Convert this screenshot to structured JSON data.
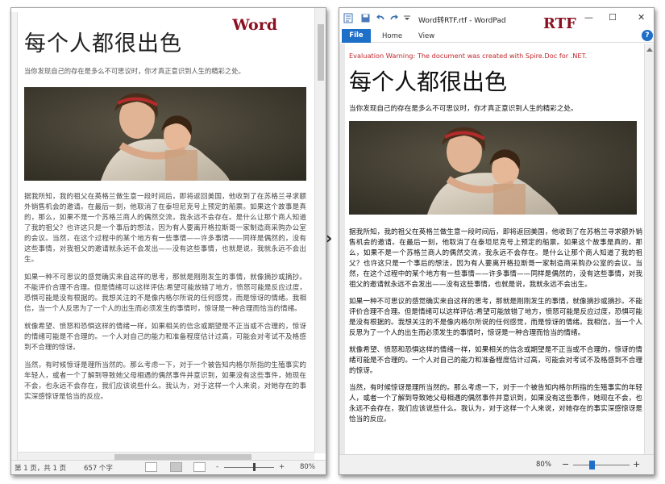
{
  "word": {
    "label": "Word",
    "doc_title": "每个人都很出色",
    "subtitle": "当你发现自己的存在是多么不可思议时，你才真正意识到人生的精彩之处。",
    "paragraphs": [
      "据我所知，我的祖父在英格兰做生意一段时间后，即将返回美国，他收到了在苏格兰寻求额外销售机会的邀请。在最后一刻，他取消了在泰坦尼克号上预定的船票。如果这个故事是真的，那么，如果不是一个苏格兰商人的偶然交流，我永远不会存在。是什么让那个商人知道了我的祖父？也许这只是一个事后的想法，因为有人要离开格拉斯哥一家制造商采购办公室的会议。当然，在这个过程中的某个地方有一些事情——许多事情——同样是偶然的，没有这些事情，对我祖父的邀请就永远不会发出——没有这些事情，也就是说，我就永远不会出生。",
      "如果一种不可思议的感觉确实来自这样的思考，那就是刚刚发生的事情，就像摘抄或摘抄。不能评价合理不合理。但是情绪可以这样评估:希望可能放错了地方，愤怒可能是反应过度，恐惧可能是没有根据的。我想关注的不是像内格尔所说的任何感觉，而是惊讶的情绪。我相信，当一个人反思为了一个人的出生而必须发生的事情时，惊讶是一种合理而恰当的情绪。",
      "就像希望、愤怒和恐惧这样的情绪一样，如果相关的信念或期望是不正当或不合理的，惊讶的情绪可能是不合理的。一个人对自己的能力和准备程度估计过高，可能会对考试不及格感到不合理的惊讶。",
      "当然，有时候惊讶是理所当然的。那么考虑一下，对于一个被告知内格尔所指的生殖事实的年轻人，或者一个了解到导致她父母相遇的偶然事件并意识到，如果没有这些事件，她现在不会，也永远不会存在，我们应该说些什么。我认为，对于这样一个人来说，对她存在的事实深感惊讶是恰当的反应。"
    ],
    "status": {
      "page": "第 1 页，共 1 页",
      "words": "657 个字",
      "zoom": "80%",
      "zoom_minus": "-",
      "zoom_plus": "+"
    }
  },
  "wordpad": {
    "label": "RTF",
    "window_title": "Word转RTF.rtf - WordPad",
    "tabs": [
      "File",
      "Home",
      "View"
    ],
    "help": "?",
    "controls": {
      "minimize": "—",
      "maximize": "☐",
      "close": "✕"
    },
    "warning": "Evaluation Warning: The document was created with Spire.Doc for .NET.",
    "doc_title": "每个人都很出色",
    "subtitle": "当你发现自己的存在是多么不可思议时，你才真正意识到人生的精彩之处。",
    "paragraphs": [
      "据我所知，我的祖父在英格兰做生意一段时间后，即将返回美国，他收到了在苏格兰寻求额外销售机会的邀请。在最后一刻，他取消了在泰坦尼克号上预定的船票。如果这个故事是真的，那么，如果不是一个苏格兰商人的偶然交流，我永远不会存在。是什么让那个商人知道了我的祖父？也许这只是一个事后的想法，因为有人要离开格拉斯哥一家制造商采购办公室的会议。当然，在这个过程中的某个地方有一些事情——许多事情——同样是偶然的，没有这些事情，对我祖父的邀请就永远不会发出——没有这些事情，也就是说，我就永远不会出生。",
      "如果一种不可思议的感觉确实来自这样的思考，那就是刚刚发生的事情，就像摘抄或摘抄。不能评价合理不合理。但是情绪可以这样评估:希望可能放错了地方，愤怒可能是反应过度，恐惧可能是没有根据的。我想关注的不是像内格尔所说的任何感觉，而是惊讶的情绪。我相信，当一个人反思为了一个人的出生而必须发生的事情时，惊讶是一种合理而恰当的情绪。",
      "就像希望、愤怒和恐惧这样的情绪一样，如果相关的信念或期望是不正当或不合理的，惊讶的情绪可能是不合理的。一个人对自己的能力和准备程度估计过高，可能会对考试不及格感到不合理的惊讶。",
      "当然，有时候惊讶是理所当然的。那么考虑一下，对于一个被告知内格尔所指的生殖事实的年轻人，或者一个了解到导致她父母相遇的偶然事件并意识到，如果没有这些事件，她现在不会，也永远不会存在，我们应该说些什么。我认为，对于这样一个人来说，对她存在的事实深感惊讶是恰当的反应。"
    ],
    "status": {
      "zoom": "80%",
      "zoom_minus": "−",
      "zoom_plus": "+"
    }
  },
  "arrow": "›",
  "colors": {
    "label_red": "#8b1020",
    "file_tab_blue": "#1e6fc8",
    "warning_red": "#c0282c"
  }
}
